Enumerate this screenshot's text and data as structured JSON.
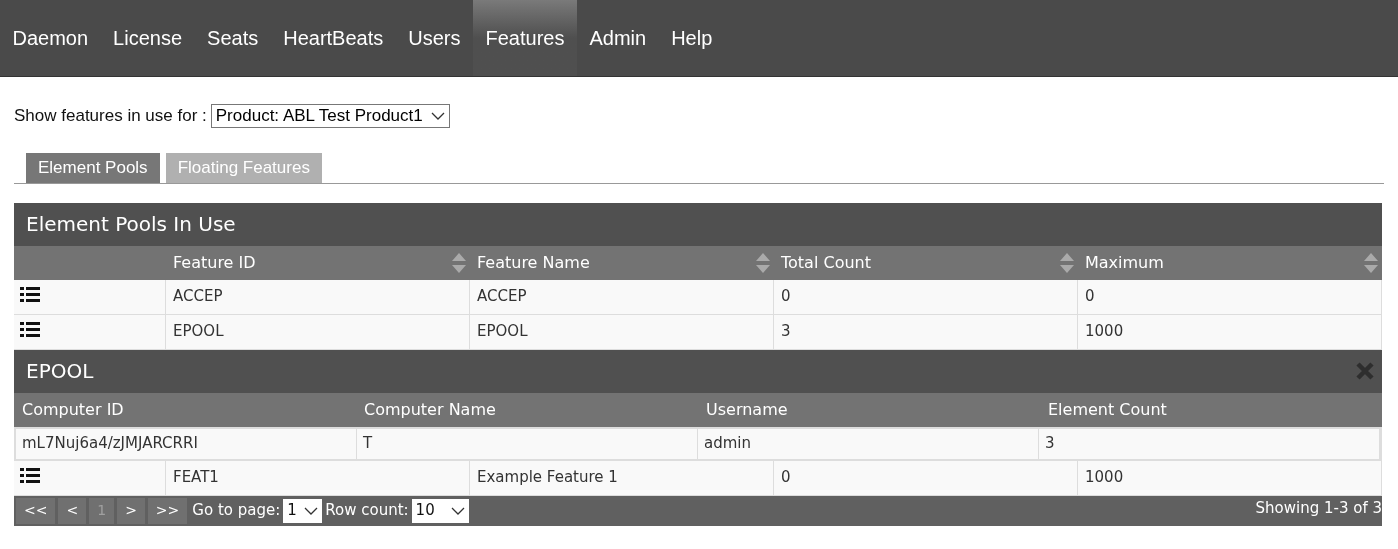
{
  "nav": [
    {
      "label": "Daemon",
      "selected": false
    },
    {
      "label": "License",
      "selected": false
    },
    {
      "label": "Seats",
      "selected": false
    },
    {
      "label": "HeartBeats",
      "selected": false
    },
    {
      "label": "Users",
      "selected": false
    },
    {
      "label": "Features",
      "selected": true
    },
    {
      "label": "Admin",
      "selected": false
    },
    {
      "label": "Help",
      "selected": false
    }
  ],
  "filter": {
    "label": "Show features in use for :",
    "value": "Product: ABL Test Product1"
  },
  "tabs": [
    {
      "label": "Element Pools",
      "selected": true
    },
    {
      "label": "Floating Features",
      "selected": false
    }
  ],
  "table": {
    "title": "Element Pools In Use",
    "columns": [
      "Feature ID",
      "Feature Name",
      "Total Count",
      "Maximum"
    ],
    "rows": [
      {
        "cells": [
          "ACCEP",
          "ACCEP",
          "0",
          "0"
        ]
      },
      {
        "cells": [
          "EPOOL",
          "EPOOL",
          "3",
          "1000"
        ],
        "detail": {
          "title": "EPOOL",
          "columns": [
            "Computer ID",
            "Computer Name",
            "Username",
            "Element Count"
          ],
          "rows": [
            [
              "mL7Nuj6a4/zJMJARCRRI",
              "T",
              "admin",
              "3"
            ]
          ]
        }
      },
      {
        "cells": [
          "FEAT1",
          "Example Feature 1",
          "0",
          "1000"
        ]
      }
    ]
  },
  "pager": {
    "buttons": [
      {
        "label": "<<",
        "disabled": false
      },
      {
        "label": "<",
        "disabled": false
      },
      {
        "label": "1",
        "disabled": true
      },
      {
        "label": ">",
        "disabled": false
      },
      {
        "label": ">>",
        "disabled": false
      }
    ],
    "page_label": "Go to page:",
    "page": "1",
    "rowcount_label": "Row count:",
    "rowcount": "10",
    "status": "Showing 1-3 of 3"
  }
}
